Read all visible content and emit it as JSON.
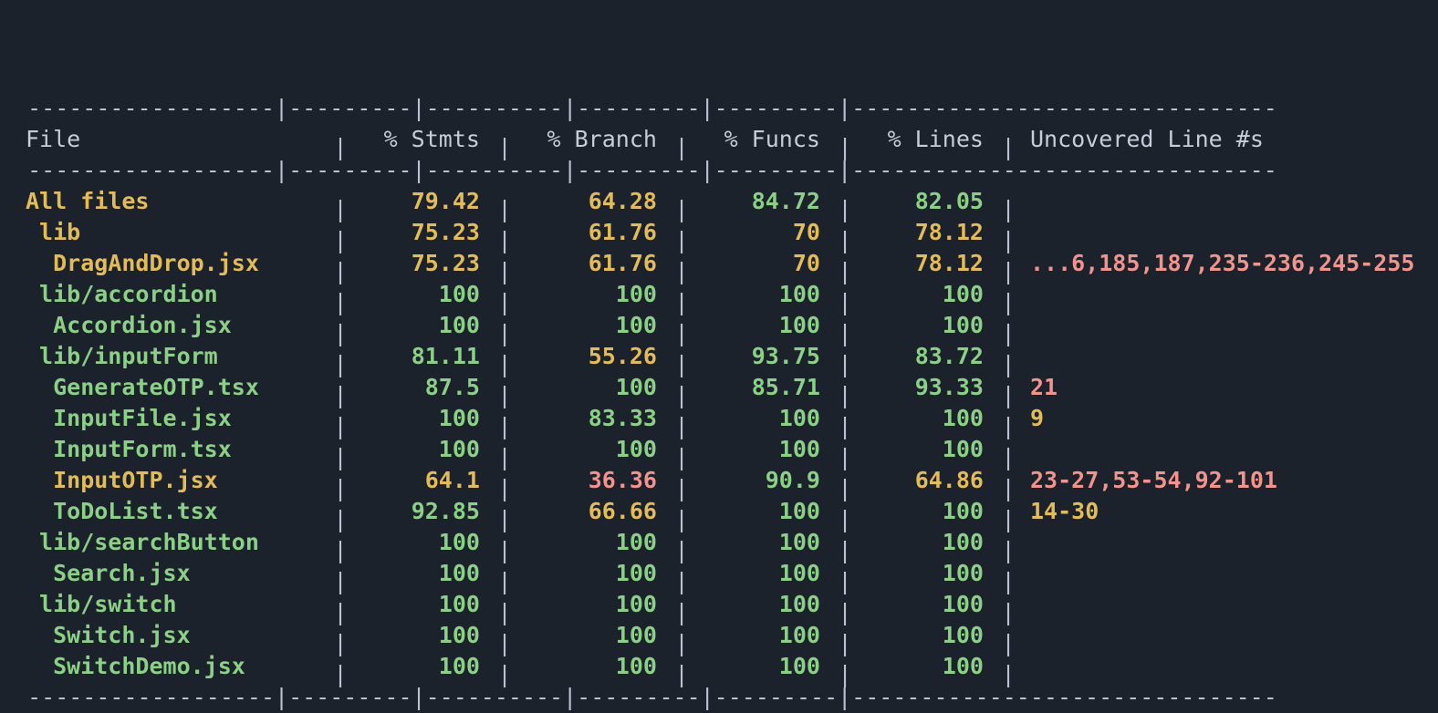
{
  "terminal": {
    "background": "#1c222c",
    "header_color": "#c5cdd8",
    "rule_color": "#b9c2d0",
    "colors": {
      "green": "#8bd185",
      "yellow": "#e3bc56",
      "red": "#f2948c"
    }
  },
  "table": {
    "columns": [
      {
        "key": "file",
        "label": "File",
        "align": "left"
      },
      {
        "key": "stmts",
        "label": "% Stmts",
        "align": "right"
      },
      {
        "key": "branch",
        "label": "% Branch",
        "align": "right"
      },
      {
        "key": "funcs",
        "label": "% Funcs",
        "align": "right"
      },
      {
        "key": "lines",
        "label": "% Lines",
        "align": "right"
      },
      {
        "key": "uncovered",
        "label": "Uncovered Line #s",
        "align": "left"
      }
    ],
    "rules": {
      "top": "------------------|---------|----------|---------|---------|-------------------------------",
      "middle": "------------------|---------|----------|---------|---------|-------------------------------",
      "bottom": "------------------|---------|----------|---------|---------|-------------------------------"
    },
    "rows": [
      {
        "file": "All files",
        "indent": 0,
        "file_color": "yellow",
        "stmts": "79.42",
        "stmts_color": "yellow",
        "branch": "64.28",
        "branch_color": "yellow",
        "funcs": "84.72",
        "funcs_color": "green",
        "lines": "82.05",
        "lines_color": "green",
        "uncovered": "",
        "uncovered_color": "red"
      },
      {
        "file": "lib",
        "indent": 1,
        "file_color": "yellow",
        "stmts": "75.23",
        "stmts_color": "yellow",
        "branch": "61.76",
        "branch_color": "yellow",
        "funcs": "70",
        "funcs_color": "yellow",
        "lines": "78.12",
        "lines_color": "yellow",
        "uncovered": "",
        "uncovered_color": "red"
      },
      {
        "file": "DragAndDrop.jsx",
        "indent": 2,
        "file_color": "yellow",
        "stmts": "75.23",
        "stmts_color": "yellow",
        "branch": "61.76",
        "branch_color": "yellow",
        "funcs": "70",
        "funcs_color": "yellow",
        "lines": "78.12",
        "lines_color": "yellow",
        "uncovered": "...6,185,187,235-236,245-255",
        "uncovered_color": "red"
      },
      {
        "file": "lib/accordion",
        "indent": 1,
        "file_color": "green",
        "stmts": "100",
        "stmts_color": "green",
        "branch": "100",
        "branch_color": "green",
        "funcs": "100",
        "funcs_color": "green",
        "lines": "100",
        "lines_color": "green",
        "uncovered": "",
        "uncovered_color": "red"
      },
      {
        "file": "Accordion.jsx",
        "indent": 2,
        "file_color": "green",
        "stmts": "100",
        "stmts_color": "green",
        "branch": "100",
        "branch_color": "green",
        "funcs": "100",
        "funcs_color": "green",
        "lines": "100",
        "lines_color": "green",
        "uncovered": "",
        "uncovered_color": "red"
      },
      {
        "file": "lib/inputForm",
        "indent": 1,
        "file_color": "green",
        "stmts": "81.11",
        "stmts_color": "green",
        "branch": "55.26",
        "branch_color": "yellow",
        "funcs": "93.75",
        "funcs_color": "green",
        "lines": "83.72",
        "lines_color": "green",
        "uncovered": "",
        "uncovered_color": "red"
      },
      {
        "file": "GenerateOTP.tsx",
        "indent": 2,
        "file_color": "green",
        "stmts": "87.5",
        "stmts_color": "green",
        "branch": "100",
        "branch_color": "green",
        "funcs": "85.71",
        "funcs_color": "green",
        "lines": "93.33",
        "lines_color": "green",
        "uncovered": "21",
        "uncovered_color": "red"
      },
      {
        "file": "InputFile.jsx",
        "indent": 2,
        "file_color": "green",
        "stmts": "100",
        "stmts_color": "green",
        "branch": "83.33",
        "branch_color": "green",
        "funcs": "100",
        "funcs_color": "green",
        "lines": "100",
        "lines_color": "green",
        "uncovered": "9",
        "uncovered_color": "yellow"
      },
      {
        "file": "InputForm.tsx",
        "indent": 2,
        "file_color": "green",
        "stmts": "100",
        "stmts_color": "green",
        "branch": "100",
        "branch_color": "green",
        "funcs": "100",
        "funcs_color": "green",
        "lines": "100",
        "lines_color": "green",
        "uncovered": "",
        "uncovered_color": "red"
      },
      {
        "file": "InputOTP.jsx",
        "indent": 2,
        "file_color": "yellow",
        "stmts": "64.1",
        "stmts_color": "yellow",
        "branch": "36.36",
        "branch_color": "red",
        "funcs": "90.9",
        "funcs_color": "green",
        "lines": "64.86",
        "lines_color": "yellow",
        "uncovered": "23-27,53-54,92-101",
        "uncovered_color": "red"
      },
      {
        "file": "ToDoList.tsx",
        "indent": 2,
        "file_color": "green",
        "stmts": "92.85",
        "stmts_color": "green",
        "branch": "66.66",
        "branch_color": "yellow",
        "funcs": "100",
        "funcs_color": "green",
        "lines": "100",
        "lines_color": "green",
        "uncovered": "14-30",
        "uncovered_color": "yellow"
      },
      {
        "file": "lib/searchButton",
        "indent": 1,
        "file_color": "green",
        "stmts": "100",
        "stmts_color": "green",
        "branch": "100",
        "branch_color": "green",
        "funcs": "100",
        "funcs_color": "green",
        "lines": "100",
        "lines_color": "green",
        "uncovered": "",
        "uncovered_color": "red"
      },
      {
        "file": "Search.jsx",
        "indent": 2,
        "file_color": "green",
        "stmts": "100",
        "stmts_color": "green",
        "branch": "100",
        "branch_color": "green",
        "funcs": "100",
        "funcs_color": "green",
        "lines": "100",
        "lines_color": "green",
        "uncovered": "",
        "uncovered_color": "red"
      },
      {
        "file": "lib/switch",
        "indent": 1,
        "file_color": "green",
        "stmts": "100",
        "stmts_color": "green",
        "branch": "100",
        "branch_color": "green",
        "funcs": "100",
        "funcs_color": "green",
        "lines": "100",
        "lines_color": "green",
        "uncovered": "",
        "uncovered_color": "red"
      },
      {
        "file": "Switch.jsx",
        "indent": 2,
        "file_color": "green",
        "stmts": "100",
        "stmts_color": "green",
        "branch": "100",
        "branch_color": "green",
        "funcs": "100",
        "funcs_color": "green",
        "lines": "100",
        "lines_color": "green",
        "uncovered": "",
        "uncovered_color": "red"
      },
      {
        "file": "SwitchDemo.jsx",
        "indent": 2,
        "file_color": "green",
        "stmts": "100",
        "stmts_color": "green",
        "branch": "100",
        "branch_color": "green",
        "funcs": "100",
        "funcs_color": "green",
        "lines": "100",
        "lines_color": "green",
        "uncovered": "",
        "uncovered_color": "red"
      }
    ]
  }
}
